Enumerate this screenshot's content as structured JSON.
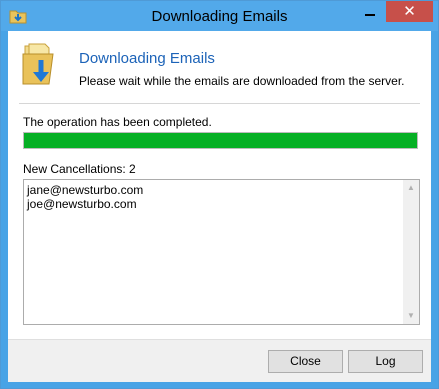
{
  "window": {
    "title": "Downloading Emails",
    "close_glyph": "✕"
  },
  "header": {
    "title": "Downloading Emails",
    "description": "Please wait while the emails are downloaded from the server.",
    "icon": "folder-download-icon"
  },
  "status": {
    "text": "The operation has been completed.",
    "progress_fraction": 1.0,
    "progress_color": "#06b025"
  },
  "cancellations": {
    "label": "New Cancellations: 2",
    "items": [
      "jane@newsturbo.com",
      "joe@newsturbo.com"
    ]
  },
  "footer": {
    "close_label": "Close",
    "log_label": "Log"
  }
}
